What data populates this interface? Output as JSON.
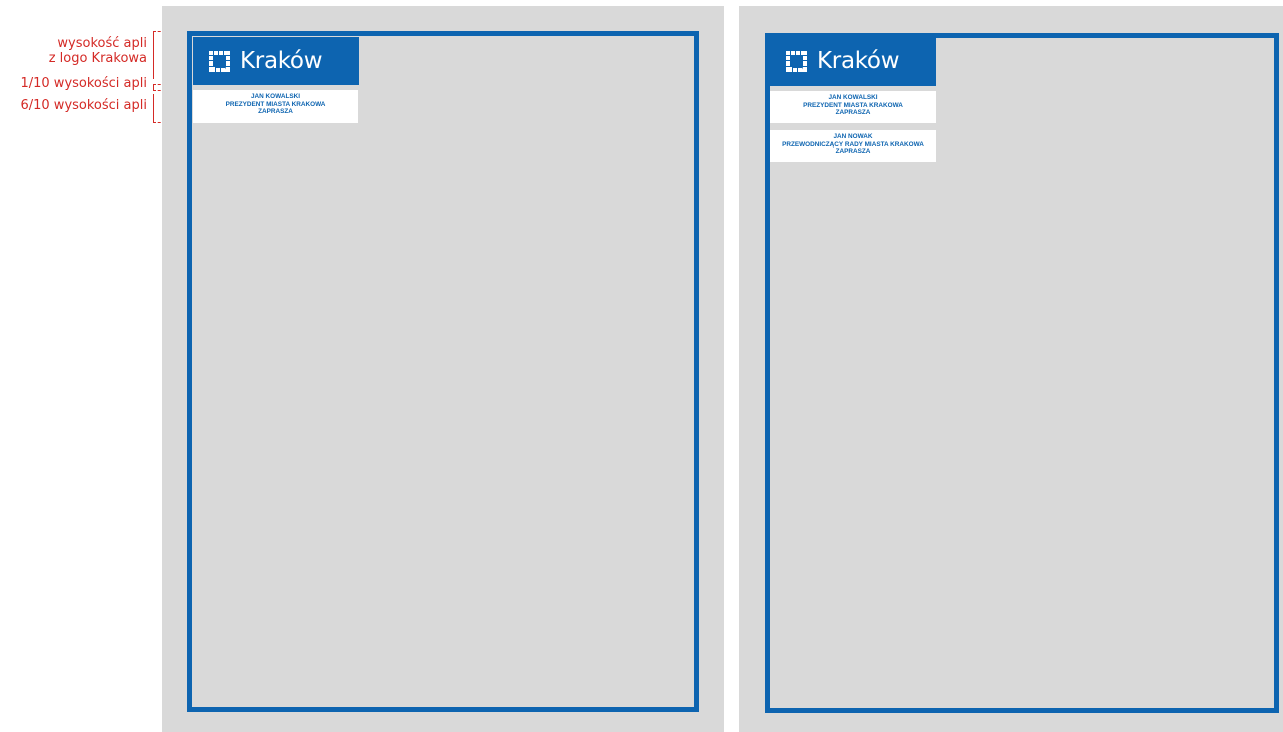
{
  "annotations": {
    "logo_height_line1": "wysokość apli",
    "logo_height_line2": "z logo Krakowa",
    "gap_height": "1/10 wysokości apli",
    "text_height": "6/10 wysokości apli"
  },
  "logo": {
    "text": "Kraków",
    "icon": "krakow-logo-icon"
  },
  "left_sheet": {
    "invitation": {
      "name": "JAN KOWALSKI",
      "title": "PREZYDENT MIASTA KRAKOWA",
      "action": "ZAPRASZA"
    }
  },
  "right_sheet": {
    "invitations": [
      {
        "name": "JAN KOWALSKI",
        "title": "PREZYDENT MIASTA KRAKOWA",
        "action": "ZAPRASZA"
      },
      {
        "name": "JAN NOWAK",
        "title": "PRZEWODNICZĄCY RADY MIASTA KRAKOWA",
        "action": "ZAPRASZA"
      }
    ]
  },
  "colors": {
    "brand_blue": "#0d64b0",
    "annotation_red": "#d42a26",
    "sheet_gray": "#d9d9d9"
  }
}
